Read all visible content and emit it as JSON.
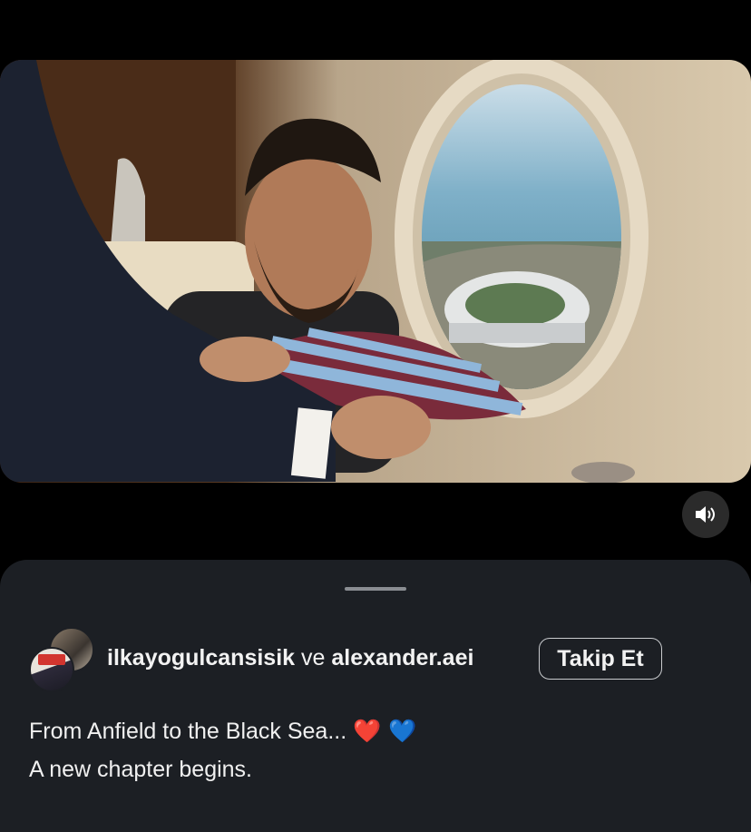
{
  "post": {
    "media_alt_icon": "video-frame",
    "sound_icon": "speaker-icon"
  },
  "sheet": {
    "user1": "ilkayogulcansisik",
    "joiner": "ve",
    "user2": "alexander.aei",
    "follow_label": "Takip Et",
    "caption_line1": "From Anfield to the Black Sea...",
    "caption_emoji": "❤️ 💙",
    "caption_line2": "A new chapter begins."
  },
  "colors": {
    "sheet_bg": "#1c1f24",
    "background": "#000000",
    "jersey_claret": "#7a2b3b",
    "jersey_blue": "#8fb6da"
  }
}
